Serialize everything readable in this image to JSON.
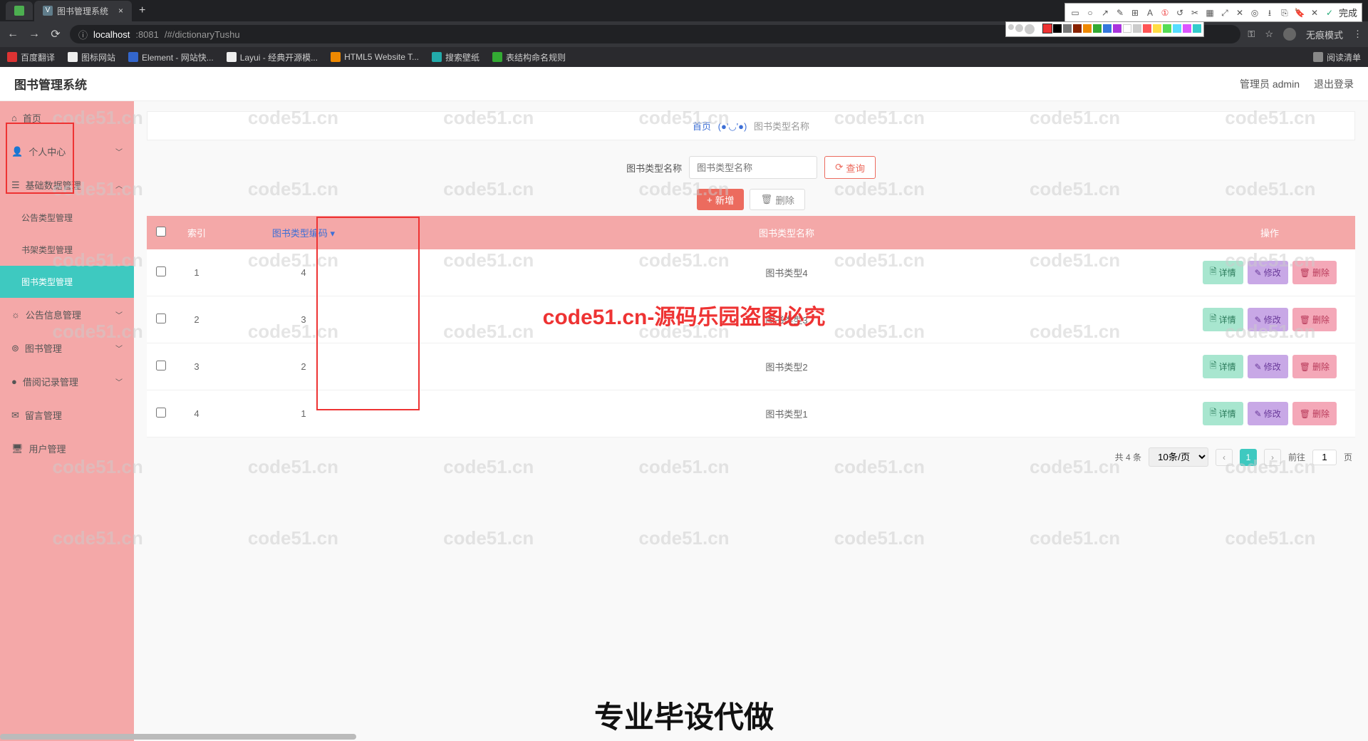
{
  "browser": {
    "tabs": [
      {
        "icon": "green",
        "title": ""
      },
      {
        "icon": "v",
        "title": "图书管理系统",
        "active": true
      }
    ],
    "url_prefix": "localhost",
    "url_port": ":8081",
    "url_path": "/#/dictionaryTushu",
    "incognito": "无痕模式",
    "bookmarks": [
      {
        "label": "百度翻译",
        "ico": "red"
      },
      {
        "label": "图标网站",
        "ico": "white"
      },
      {
        "label": "Element - 网站快...",
        "ico": "blue"
      },
      {
        "label": "Layui - 经典开源模...",
        "ico": "white"
      },
      {
        "label": "HTML5 Website T...",
        "ico": "orange"
      },
      {
        "label": "搜索壁纸",
        "ico": "teal"
      },
      {
        "label": "表结构命名规则",
        "ico": "green"
      }
    ],
    "bookmark_right": "阅读清单"
  },
  "annot": {
    "finish": "完成"
  },
  "header": {
    "title": "图书管理系统",
    "user": "管理员 admin",
    "logout": "退出登录"
  },
  "sidebar": {
    "items": [
      {
        "label": "首页",
        "icon": "home"
      },
      {
        "label": "个人中心",
        "icon": "user",
        "chev": true
      },
      {
        "label": "基础数据管理",
        "icon": "list",
        "chev": true,
        "open": true
      },
      {
        "label": "公告类型管理",
        "sub": true
      },
      {
        "label": "书架类型管理",
        "sub": true
      },
      {
        "label": "图书类型管理",
        "sub": true,
        "active": true
      },
      {
        "label": "公告信息管理",
        "icon": "bell",
        "chev": true
      },
      {
        "label": "图书管理",
        "icon": "book",
        "chev": true
      },
      {
        "label": "借阅记录管理",
        "icon": "pin",
        "chev": true
      },
      {
        "label": "留言管理",
        "icon": "mail"
      },
      {
        "label": "用户管理",
        "icon": "monitor"
      }
    ]
  },
  "breadcrumb": {
    "home": "首页",
    "face": "(●'◡'●)",
    "current": "图书类型名称"
  },
  "search": {
    "label": "图书类型名称",
    "placeholder": "图书类型名称",
    "btn": "查询"
  },
  "actions": {
    "add": "新增",
    "del": "删除"
  },
  "table": {
    "cols": {
      "index": "索引",
      "code": "图书类型编码",
      "name": "图书类型名称",
      "ops": "操作"
    },
    "rows": [
      {
        "idx": "1",
        "code": "4",
        "name": "图书类型4"
      },
      {
        "idx": "2",
        "code": "3",
        "name": "图书类型3"
      },
      {
        "idx": "3",
        "code": "2",
        "name": "图书类型2"
      },
      {
        "idx": "4",
        "code": "1",
        "name": "图书类型1"
      }
    ],
    "btn_detail": "详情",
    "btn_edit": "修改",
    "btn_delete": "删除"
  },
  "pager": {
    "total": "共 4 条",
    "size": "10条/页",
    "page": "1",
    "goto": "前往",
    "goto_val": "1",
    "goto_suffix": "页"
  },
  "watermark": {
    "text": "code51.cn",
    "center": "code51.cn-源码乐园盗图必究",
    "bottom": "专业毕设代做"
  }
}
